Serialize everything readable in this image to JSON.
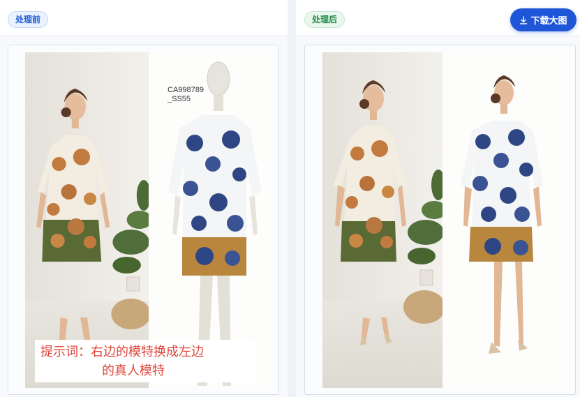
{
  "before_panel": {
    "badge": "处理前"
  },
  "after_panel": {
    "badge": "处理后",
    "download_label": "下载大图"
  },
  "sku_label": {
    "line1": "CA998789",
    "line2": "_SS55"
  },
  "prompt_overlay": {
    "line1": "提示词：右边的模特换成左边",
    "line2": "的真人模特"
  },
  "colors": {
    "accent": "#1f56d8",
    "prompt_text": "#e0453a",
    "badge_before": "#1f5fd6",
    "badge_after": "#1f8a45"
  },
  "icons": {
    "download": "download-icon"
  }
}
